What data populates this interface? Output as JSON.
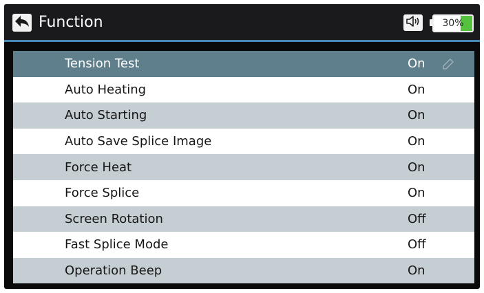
{
  "header": {
    "title": "Function",
    "back_icon": "back-arrow-icon",
    "speaker_icon": "speaker-icon",
    "battery": {
      "text": "30%",
      "level": 0.3,
      "fill_color": "#54c23c"
    },
    "accent_color": "#4a88b6"
  },
  "settings": {
    "selected_index": 0,
    "items": [
      {
        "label": "Tension Test",
        "value": "On"
      },
      {
        "label": "Auto Heating",
        "value": "On"
      },
      {
        "label": "Auto Starting",
        "value": "On"
      },
      {
        "label": "Auto Save Splice Image",
        "value": "On"
      },
      {
        "label": "Force Heat",
        "value": "On"
      },
      {
        "label": "Force Splice",
        "value": "On"
      },
      {
        "label": "Screen Rotation",
        "value": "Off"
      },
      {
        "label": "Fast Splice Mode",
        "value": "Off"
      },
      {
        "label": "Operation Beep",
        "value": "On"
      }
    ],
    "edit_icon": "pencil-icon",
    "colors": {
      "selected": "#5e7f8b",
      "alt_row": "#c5ced2",
      "row": "#ffffff"
    }
  }
}
